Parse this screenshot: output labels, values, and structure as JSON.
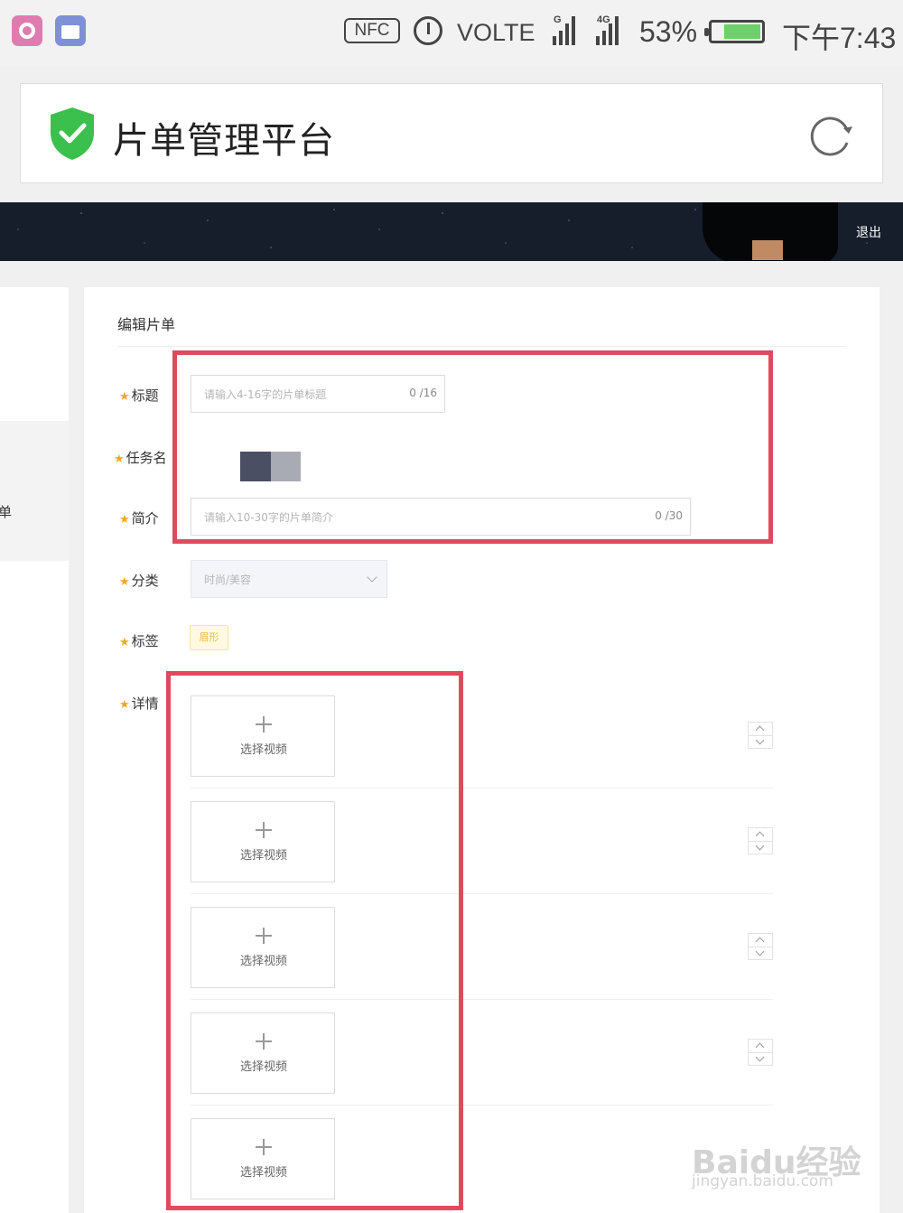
{
  "status_bar": {
    "nfc": "NFC",
    "volte": "VOLTE",
    "signal1_label": "G",
    "signal2_label": "4G",
    "battery_percent": "53%",
    "battery_level": 0.53,
    "time": "下午7:43"
  },
  "header": {
    "title": "片单管理平台",
    "logo_icon": "shield-check-icon",
    "refresh_icon": "refresh-icon"
  },
  "banner": {
    "logout_label": "退出"
  },
  "sidebar": {
    "partial_label": "单"
  },
  "form": {
    "section_title": "编辑片单",
    "title_field": {
      "label": "标题",
      "placeholder": "请输入4-16字的片单标题",
      "counter": "0 /16"
    },
    "task_field": {
      "label": "任务名"
    },
    "intro_field": {
      "label": "简介",
      "placeholder": "请输入10-30字的片单简介",
      "counter": "0 /30"
    },
    "category_field": {
      "label": "分类",
      "value": "时尚/美容"
    },
    "tags_field": {
      "label": "标签",
      "tag": "眉形"
    },
    "details_field": {
      "label": "详情",
      "items": [
        {
          "label": "选择视频"
        },
        {
          "label": "选择视频"
        },
        {
          "label": "选择视频"
        },
        {
          "label": "选择视频"
        },
        {
          "label": "选择视频"
        }
      ]
    },
    "required_mark": "★"
  },
  "watermark": {
    "line1": "Baidu经验",
    "line2": "jingyan.baidu.com"
  },
  "colors": {
    "accent_red": "#e04a5f",
    "star": "#f5a623",
    "shield_green": "#3cc04d"
  }
}
